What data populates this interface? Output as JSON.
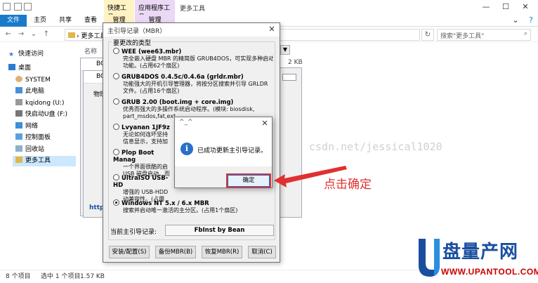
{
  "explorer": {
    "window_title": "更多工具",
    "context_tabs": [
      "快捷工具",
      "应用程序工具"
    ],
    "ribbon_tabs": [
      "文件",
      "主页",
      "共享",
      "查看"
    ],
    "context_sub_tabs": [
      "管理",
      "管理"
    ],
    "address": "更多工具",
    "search_placeholder": "搜索\"更多工具\"",
    "column_name_header": "名称",
    "nav_items": [
      {
        "label": "快速访问",
        "icon": "star-icon"
      },
      {
        "label": "桌面",
        "icon": "desktop-icon"
      },
      {
        "label": "SYSTEM",
        "icon": "user-icon"
      },
      {
        "label": "此电脑",
        "icon": "pc-icon"
      },
      {
        "label": "kqidong (U:)",
        "icon": "drive-icon"
      },
      {
        "label": "快启动U盘 (F:)",
        "icon": "usb-drive-icon"
      },
      {
        "label": "网络",
        "icon": "network-icon"
      },
      {
        "label": "控制面板",
        "icon": "control-panel-icon"
      },
      {
        "label": "回收站",
        "icon": "recycle-bin-icon"
      },
      {
        "label": "更多工具",
        "icon": "folder-icon"
      }
    ],
    "selected_nav_index": 9,
    "status_count": "8 个项目",
    "status_selected": "选中 1 个项目",
    "status_size": "1.57 KB",
    "file_size_visible": "2 KB"
  },
  "bg_windows": {
    "title_fragment": "BO",
    "tab_fragment": "物理",
    "link_fragment": "https"
  },
  "mbr_dialog": {
    "title": "主引导记录（MBR）",
    "group_label": "要更改的类型",
    "options": [
      {
        "name": "WEE (wee63.mbr)",
        "desc": [
          "完全嵌入硬盘 MBR 的精简版 GRUB4DOS，可实现多种启动",
          "功能。(占用62个扇区)"
        ],
        "selected": false
      },
      {
        "name": "GRUB4DOS 0.4.5c/0.4.6a (grldr.mbr)",
        "desc": [
          "功能强大的开机引导管理器，将按分区搜索并引导 GRLDR",
          "文件。(占用16个扇区)"
        ],
        "selected": false
      },
      {
        "name": "GRUB 2.00 (boot.img + core.img)",
        "desc": [
          "优秀而强大的多操作系统启动程序。(模块: biosdisk,",
          "part_msdos,fat,ext"
        ],
        "selected": false
      },
      {
        "name": "Lvyanan 1JF9z",
        "desc": [
          "无论如何连坏坚持",
          "信息显示，支持加"
        ],
        "selected": false
      },
      {
        "name": "Plop Boot Manag",
        "desc": [
          "一个界面很酷的启",
          "USB 磁盘启动，而"
        ],
        "selected": false
      },
      {
        "name": "UltraISO USB-HD",
        "desc": [
          "增强的 USB-HDD",
          "动兼容性。(占用"
        ],
        "selected": false
      },
      {
        "name": "Windows NT 5.x / 6.x MBR",
        "desc": [
          "搜索并启动唯一激活的主分区。(占用1个扇区)"
        ],
        "selected": true
      }
    ],
    "current_label": "当前主引导记录:",
    "current_value": "FbInst by Bean",
    "buttons": [
      "安装/配置(S)",
      "备份MBR(B)",
      "恢复MBR(R)",
      "取消(C)"
    ]
  },
  "message_box": {
    "title": "^_^",
    "text": "已成功更新主引导记录。",
    "ok_label": "确定"
  },
  "annotation": "点击确定",
  "watermark": "csdn.net/jessical1020",
  "logo": {
    "main": "盘量产网",
    "sub": "WWW.UPANTOOL.COM"
  }
}
